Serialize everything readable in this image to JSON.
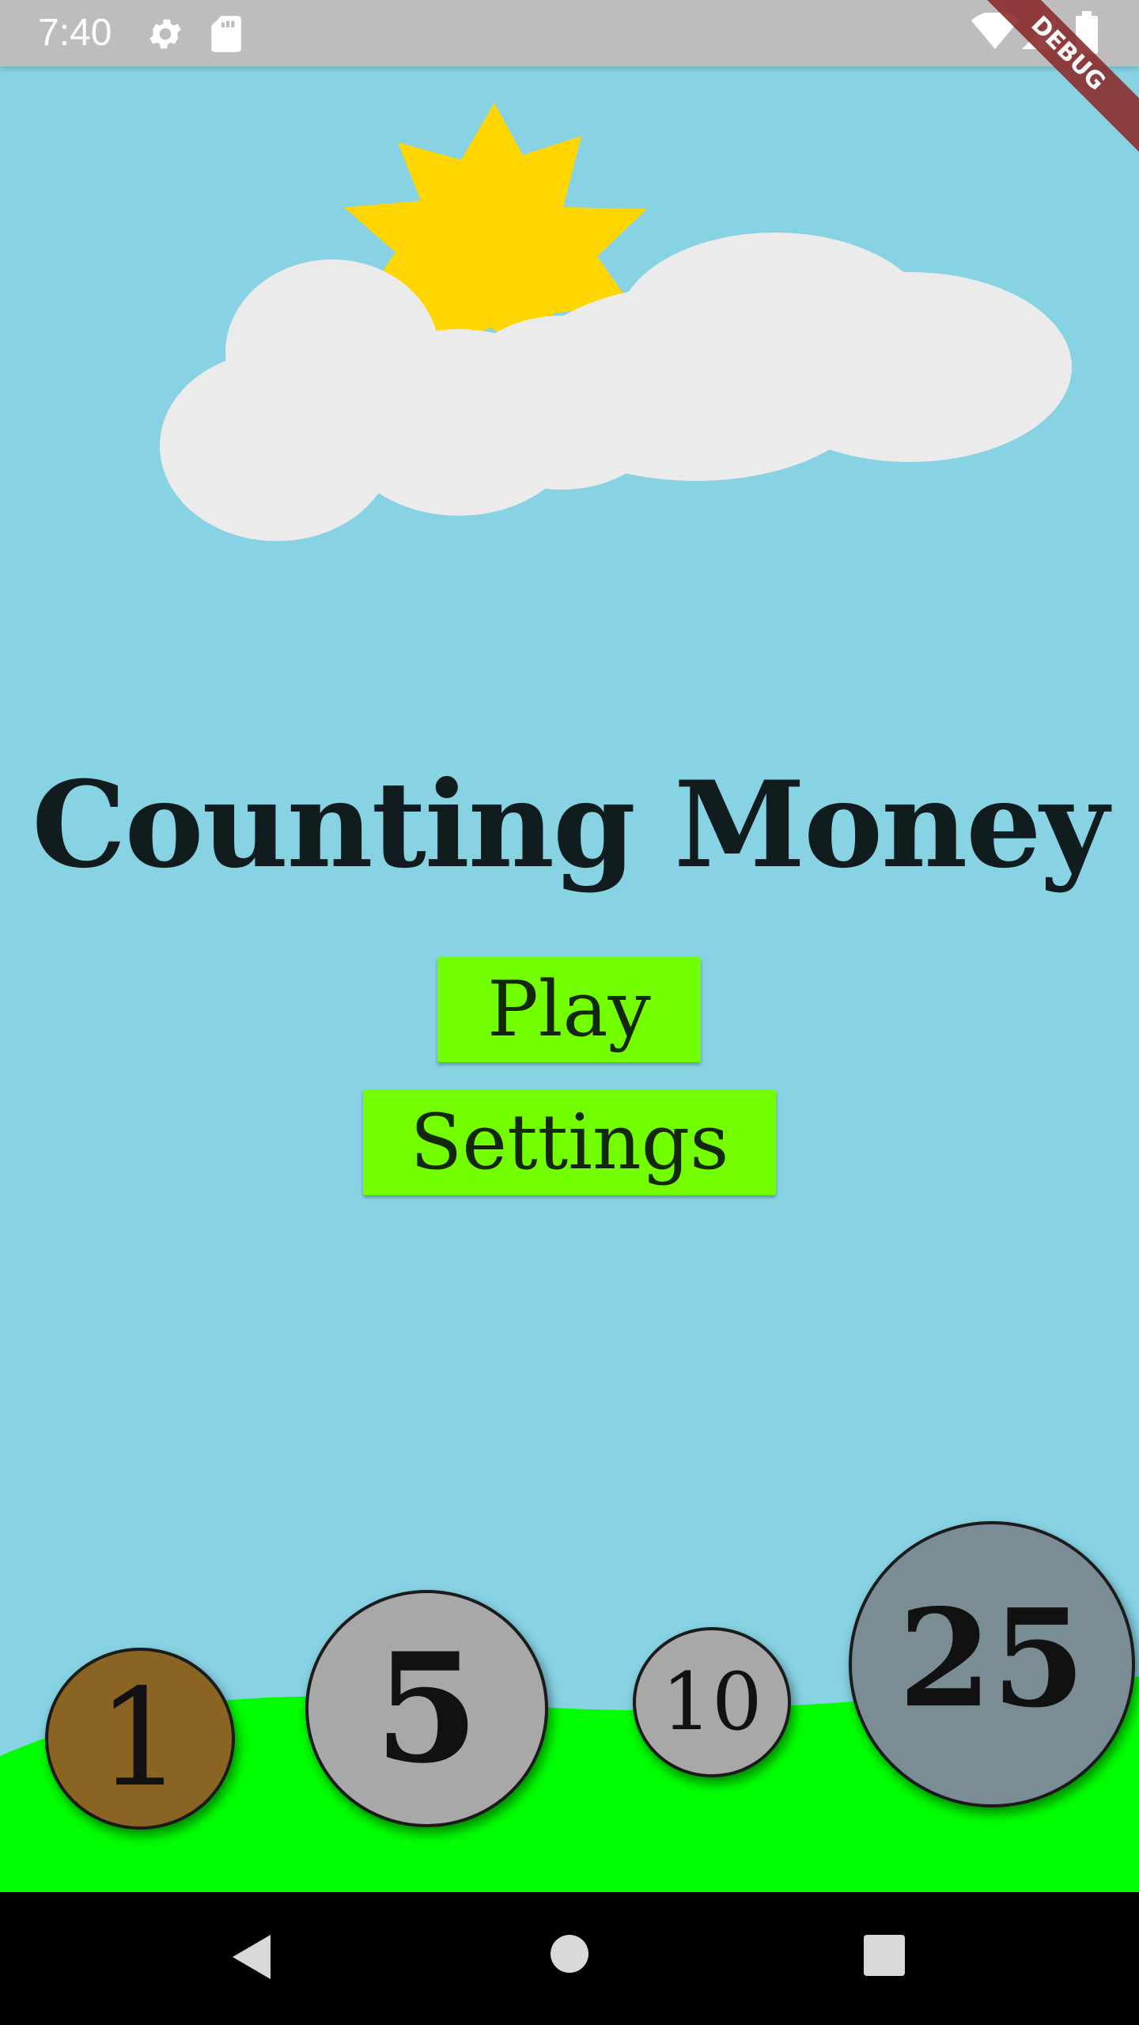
{
  "status_bar": {
    "time": "7:40",
    "icons": [
      "settings-icon",
      "sd-card-icon",
      "wifi-icon",
      "signal-icon",
      "battery-icon"
    ]
  },
  "debug_banner": "DEBUG",
  "title": "Counting Money",
  "buttons": {
    "play": "Play",
    "settings": "Settings"
  },
  "coins": [
    {
      "label": "1",
      "color": "#8a6423"
    },
    {
      "label": "5",
      "color": "#a8a8a8"
    },
    {
      "label": "10",
      "color": "#a8a8a8"
    },
    {
      "label": "25",
      "color": "#7a8c94"
    }
  ],
  "colors": {
    "sky": "#87d3e4",
    "grass": "#00ff00",
    "button": "#74ff00",
    "sun": "#ffd600",
    "cloud": "#ebebeb"
  },
  "nav_bar": {
    "icons": [
      "back-icon",
      "home-icon",
      "recents-icon"
    ]
  }
}
